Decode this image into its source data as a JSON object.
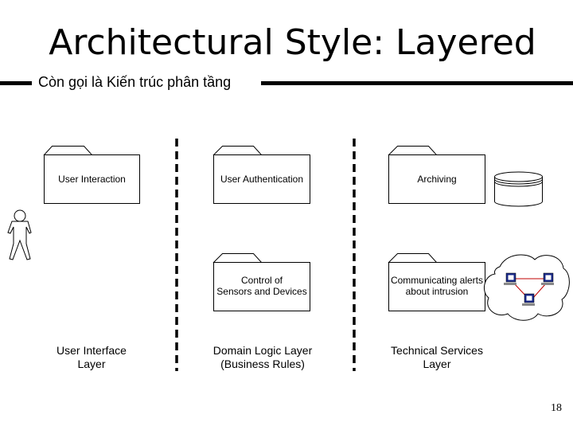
{
  "title": "Architectural Style: Layered",
  "subtitle": "Còn gọi là Kiến trúc phân tầng",
  "packages": {
    "user_interaction": "User Interaction",
    "user_authentication": "User Authentication",
    "archiving": "Archiving",
    "control_sensors_line1": "Control of",
    "control_sensors_line2": "Sensors and Devices",
    "communicating_alerts_line1": "Communicating alerts",
    "communicating_alerts_line2": "about intrusion"
  },
  "layers": {
    "ui_line1": "User Interface",
    "ui_line2": "Layer",
    "domain_line1": "Domain Logic Layer",
    "domain_line2": "(Business Rules)",
    "tech_line1": "Technical Services",
    "tech_line2": "Layer"
  },
  "icons": {
    "actor": "stick-figure-actor",
    "database": "database-cylinder",
    "network": "network-cloud"
  },
  "colors": {
    "network_link": "#c00000",
    "computer_screen": "#1a2a8a"
  },
  "page_number": "18"
}
